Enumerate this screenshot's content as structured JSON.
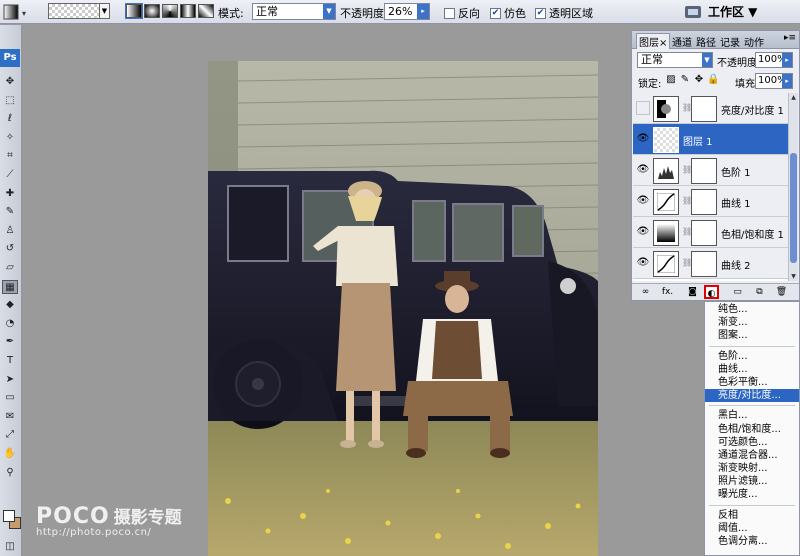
{
  "options_bar": {
    "mode_label": "模式:",
    "mode_value": "正常",
    "opacity_label": "不透明度:",
    "opacity_value": "26%",
    "reverse_label": "反向",
    "reverse_checked": false,
    "dither_label": "仿色",
    "dither_checked": true,
    "transparency_label": "透明区域",
    "transparency_checked": true,
    "workspace_label": "工作区 ▼",
    "gradient_type_icons": [
      "linear-gradient-icon",
      "radial-gradient-icon",
      "angle-gradient-icon",
      "reflected-gradient-icon",
      "diamond-gradient-icon"
    ]
  },
  "toolbox": {
    "logo": "Ps",
    "tools": [
      {
        "name": "move-tool-icon",
        "glyph": "✥"
      },
      {
        "name": "marquee-tool-icon",
        "glyph": "⬚"
      },
      {
        "name": "lasso-tool-icon",
        "glyph": "ℓ"
      },
      {
        "name": "magic-wand-tool-icon",
        "glyph": "✧"
      },
      {
        "name": "crop-tool-icon",
        "glyph": "⌗"
      },
      {
        "name": "slice-tool-icon",
        "glyph": "⟋"
      },
      {
        "name": "healing-brush-tool-icon",
        "glyph": "✚"
      },
      {
        "name": "brush-tool-icon",
        "glyph": "✎"
      },
      {
        "name": "clone-stamp-tool-icon",
        "glyph": "♙"
      },
      {
        "name": "history-brush-tool-icon",
        "glyph": "↺"
      },
      {
        "name": "eraser-tool-icon",
        "glyph": "▱"
      },
      {
        "name": "gradient-tool-icon",
        "glyph": "▦"
      },
      {
        "name": "blur-tool-icon",
        "glyph": "◆"
      },
      {
        "name": "dodge-tool-icon",
        "glyph": "◔"
      },
      {
        "name": "pen-tool-icon",
        "glyph": "✒"
      },
      {
        "name": "type-tool-icon",
        "glyph": "T"
      },
      {
        "name": "path-selection-tool-icon",
        "glyph": "➤"
      },
      {
        "name": "shape-tool-icon",
        "glyph": "▭"
      },
      {
        "name": "notes-tool-icon",
        "glyph": "✉"
      },
      {
        "name": "eyedropper-tool-icon",
        "glyph": "⤢"
      },
      {
        "name": "hand-tool-icon",
        "glyph": "✋"
      },
      {
        "name": "zoom-tool-icon",
        "glyph": "⚲"
      }
    ],
    "active_tool": "gradient-tool-icon",
    "fg_color": "#ffffff",
    "bg_color": "#c69c6d"
  },
  "watermark": {
    "main": "POCO",
    "sub": "摄影专题",
    "url": "http://photo.poco.cn/"
  },
  "layers_panel": {
    "tabs": [
      "图层",
      "通道",
      "路径",
      "记录",
      "动作"
    ],
    "active_tab": "图层",
    "tab_close": "×",
    "menu_icon": "▸≡",
    "blend_mode": "正常",
    "opacity_label": "不透明度:",
    "opacity_value": "100%",
    "lock_label": "锁定:",
    "fill_label": "填充:",
    "fill_value": "100%",
    "layers": [
      {
        "name": "亮度/对比度 1",
        "kind": "brightness",
        "visible": false,
        "selected": false
      },
      {
        "name": "图层 1",
        "kind": "pixel",
        "visible": true,
        "selected": true
      },
      {
        "name": "色阶 1",
        "kind": "levels",
        "visible": true,
        "selected": false
      },
      {
        "name": "曲线 1",
        "kind": "curves",
        "visible": true,
        "selected": false
      },
      {
        "name": "色相/饱和度 1",
        "kind": "hue",
        "visible": true,
        "selected": false
      },
      {
        "name": "曲线 2",
        "kind": "curves",
        "visible": true,
        "selected": false
      }
    ],
    "bottom_icons": [
      "link-layers-icon",
      "layer-style-icon",
      "add-mask-icon",
      "new-adjustment-layer-icon",
      "new-group-icon",
      "new-layer-icon",
      "delete-layer-icon"
    ]
  },
  "adjustment_menu": {
    "groups": [
      [
        "纯色...",
        "渐变...",
        "图案..."
      ],
      [
        "色阶...",
        "曲线...",
        "色彩平衡...",
        "亮度/对比度..."
      ],
      [
        "黑白...",
        "色相/饱和度...",
        "可选颜色...",
        "通道混合器...",
        "渐变映射...",
        "照片滤镜...",
        "曝光度..."
      ],
      [
        "反相",
        "阈值...",
        "色调分离..."
      ]
    ],
    "highlighted": "亮度/对比度..."
  }
}
